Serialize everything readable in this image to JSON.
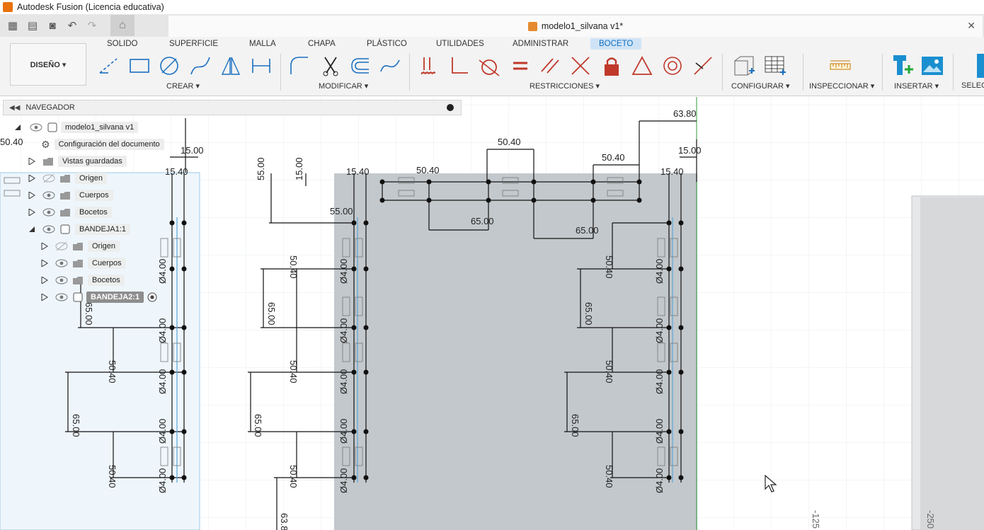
{
  "app": {
    "title": "Autodesk Fusion (Licencia educativa)"
  },
  "document": {
    "tab_title": "modelo1_silvana v1*"
  },
  "ribbon": {
    "workspace": "DISEÑO ▾",
    "tabs": [
      "SOLIDO",
      "SUPERFICIE",
      "MALLA",
      "CHAPA",
      "PLÁSTICO",
      "UTILIDADES",
      "ADMINISTRAR",
      "BOCETO"
    ],
    "active_tab": "BOCETO",
    "groups": {
      "crear": "CREAR ▾",
      "modificar": "MODIFICAR ▾",
      "restricciones": "RESTRICCIONES ▾",
      "configurar": "CONFIGURAR ▾",
      "inspeccionar": "INSPECCIONAR ▾",
      "insertar": "INSERTAR ▾",
      "seleccionar": "SELEC"
    }
  },
  "navigator": {
    "title": "NAVEGADOR",
    "root": "modelo1_silvana v1",
    "items": [
      {
        "label": "Configuración del documento"
      },
      {
        "label": "Vistas guardadas"
      },
      {
        "label": "Origen"
      },
      {
        "label": "Cuerpos"
      },
      {
        "label": "Bocetos"
      },
      {
        "label": "BANDEJA1:1"
      },
      {
        "label": "Origen"
      },
      {
        "label": "Cuerpos"
      },
      {
        "label": "Bocetos"
      },
      {
        "label": "BANDEJA2:1"
      }
    ]
  },
  "sketch": {
    "dims": {
      "d6380": "63.80",
      "d5040": "50.40",
      "d1500": "15.00",
      "d1540": "15.40",
      "d5500": "55.00",
      "d6500": "65.00",
      "d400": "Ø4.00",
      "d125": "-125",
      "d250": "-250",
      "d638": "63.8",
      "d5040b": "50.40"
    }
  }
}
